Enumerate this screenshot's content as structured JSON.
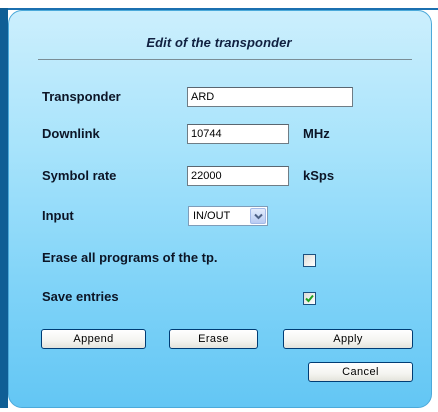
{
  "dialog": {
    "title": "Edit of the transponder"
  },
  "fields": {
    "transponder": {
      "label": "Transponder",
      "value": "ARD"
    },
    "downlink": {
      "label": "Downlink",
      "value": "10744",
      "unit": "MHz"
    },
    "symbol_rate": {
      "label": "Symbol rate",
      "value": "22000",
      "unit": "kSps"
    },
    "input": {
      "label": "Input",
      "selected": "IN/OUT"
    },
    "erase_all": {
      "label": "Erase all programs of the tp.",
      "checked": false
    },
    "save_entries": {
      "label": "Save entries",
      "checked": true
    }
  },
  "buttons": {
    "append": "Append",
    "erase": "Erase",
    "apply": "Apply",
    "cancel": "Cancel"
  },
  "icons": {
    "select_arrow": "chevron-down-icon",
    "checkmark": "checkmark-icon"
  },
  "colors": {
    "panel_top": "#cceffd",
    "panel_bottom": "#63c6f4",
    "frame_accent": "#0f5e95"
  }
}
